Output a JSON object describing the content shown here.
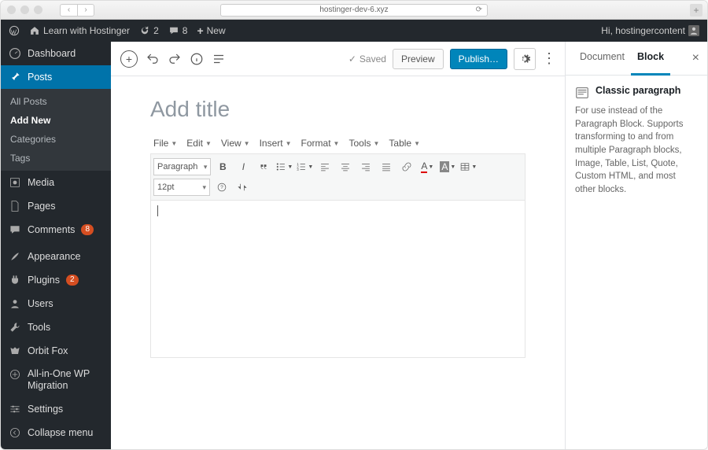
{
  "browser": {
    "url": "hostinger-dev-6.xyz"
  },
  "adminbar": {
    "site_name": "Learn with Hostinger",
    "updates_count": "2",
    "comments_count": "8",
    "new_label": "New",
    "greeting": "Hi, hostingercontent"
  },
  "sidebar": {
    "items": [
      {
        "label": "Dashboard"
      },
      {
        "label": "Posts"
      },
      {
        "label": "Media"
      },
      {
        "label": "Pages"
      },
      {
        "label": "Comments",
        "badge": "8"
      },
      {
        "label": "Appearance"
      },
      {
        "label": "Plugins",
        "badge": "2"
      },
      {
        "label": "Users"
      },
      {
        "label": "Tools"
      },
      {
        "label": "Orbit Fox"
      },
      {
        "label": "All-in-One WP Migration"
      },
      {
        "label": "Settings"
      },
      {
        "label": "Collapse menu"
      }
    ],
    "posts_sub": [
      "All Posts",
      "Add New",
      "Categories",
      "Tags"
    ]
  },
  "topbar": {
    "saved": "Saved",
    "preview": "Preview",
    "publish": "Publish…"
  },
  "post": {
    "title_placeholder": "Add title"
  },
  "mce": {
    "menu": [
      "File",
      "Edit",
      "View",
      "Insert",
      "Format",
      "Tools",
      "Table"
    ],
    "format_sel": "Paragraph",
    "size_sel": "12pt"
  },
  "inspector": {
    "tabs": {
      "document": "Document",
      "block": "Block"
    },
    "block_title": "Classic paragraph",
    "block_desc": "For use instead of the Paragraph Block. Supports transforming to and from multiple Paragraph blocks, Image, Table, List, Quote, Custom HTML, and most other blocks."
  }
}
